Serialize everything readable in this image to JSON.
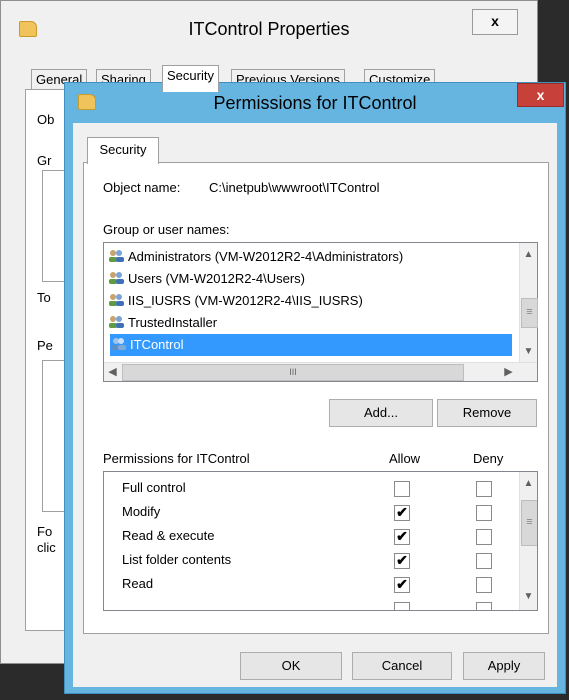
{
  "background_window": {
    "title": "ITControl Properties",
    "close_label": "x",
    "tabs": [
      "General",
      "Sharing",
      "Security",
      "Previous Versions",
      "Customize"
    ],
    "partial_labels": [
      "Ob",
      "Gr",
      "To",
      "Pe",
      "Fo",
      "clic"
    ]
  },
  "dialog": {
    "title": "Permissions for ITControl",
    "close_label": "x",
    "tab": "Security",
    "object_name_label": "Object name:",
    "object_name_value": "C:\\inetpub\\wwwroot\\ITControl",
    "group_label": "Group or user names:",
    "users": [
      {
        "label": "Administrators (VM-W2012R2-4\\Administrators)",
        "selected": false
      },
      {
        "label": "Users (VM-W2012R2-4\\Users)",
        "selected": false
      },
      {
        "label": "IIS_IUSRS (VM-W2012R2-4\\IIS_IUSRS)",
        "selected": false
      },
      {
        "label": "TrustedInstaller",
        "selected": false
      },
      {
        "label": "ITControl",
        "selected": true
      }
    ],
    "add_button": "Add...",
    "remove_button": "Remove",
    "permissions_label": "Permissions for ITControl",
    "allow_header": "Allow",
    "deny_header": "Deny",
    "permissions": [
      {
        "name": "Full control",
        "allow": false,
        "deny": false
      },
      {
        "name": "Modify",
        "allow": true,
        "deny": false
      },
      {
        "name": "Read & execute",
        "allow": true,
        "deny": false
      },
      {
        "name": "List folder contents",
        "allow": true,
        "deny": false
      },
      {
        "name": "Read",
        "allow": true,
        "deny": false
      }
    ],
    "ok_button": "OK",
    "cancel_button": "Cancel",
    "apply_button": "Apply",
    "hscroll_grip": "III",
    "scroll_grip": "≡"
  },
  "colors": {
    "accent": "#65b5e0",
    "selection": "#3399ff",
    "close_red": "#c7403a"
  }
}
